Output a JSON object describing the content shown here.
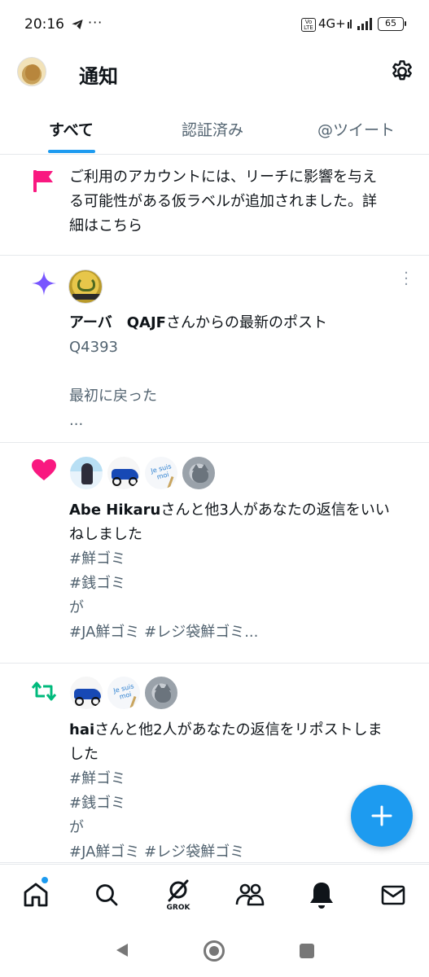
{
  "status_bar": {
    "time": "20:16",
    "dots": "···",
    "volte": "Vo LTE",
    "network": "4G+",
    "battery": "65"
  },
  "header": {
    "title": "通知"
  },
  "tabs": [
    {
      "label": "すべて",
      "active": true
    },
    {
      "label": "認証済み",
      "active": false
    },
    {
      "label": "@ツイート",
      "active": false
    }
  ],
  "notifications": [
    {
      "type": "notice",
      "icon": "flag-icon",
      "text_lines": [
        "ご利用のアカウントには、リーチに影響を与え",
        "る可能性がある仮ラベルが追加されました。詳",
        "細はこちら"
      ]
    },
    {
      "type": "new-post",
      "icon": "sparkle-icon",
      "user": "アーバ　QAJF",
      "action": "さんからの最新のポスト",
      "lines": [
        "Q4393",
        "",
        "最初に戻った",
        "..."
      ]
    },
    {
      "type": "like",
      "icon": "heart-icon",
      "user": "Abe Hikaru",
      "action_line1": "さんと他3人があなたの返信をいい",
      "action_line2": "ねしました",
      "lines": [
        "#鮮ゴミ",
        "#銭ゴミ",
        "が",
        "#JA鮮ゴミ #レジ袋鮮ゴミ..."
      ]
    },
    {
      "type": "repost",
      "icon": "repost-icon",
      "user": "hai",
      "action_line1": "さんと他2人があなたの返信をリポストしま",
      "action_line2": "した",
      "lines": [
        "#鮮ゴミ",
        "#銭ゴミ",
        "が",
        "#JA鮮ゴミ #レジ袋鮮ゴミ"
      ]
    }
  ],
  "avatar_text": {
    "sign": "Je suis moi"
  },
  "bottom_nav": {
    "grok_label": "GROK"
  },
  "colors": {
    "accent": "#1d9bf0",
    "flag": "#f91880",
    "sparkle": "#7856ff",
    "heart": "#f91880",
    "repost": "#00ba7c",
    "muted_text": "#536471"
  }
}
